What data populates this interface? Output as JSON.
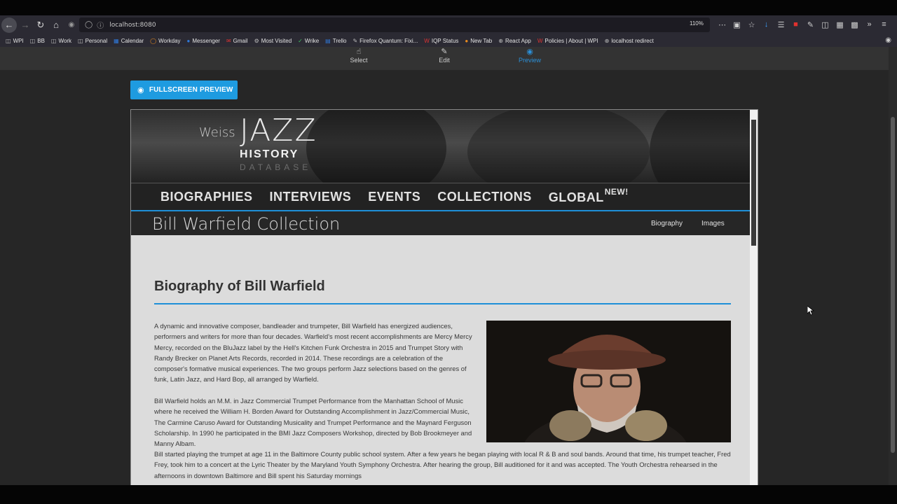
{
  "browser": {
    "url": "localhost:8080",
    "zoom": "110%",
    "bookmarks": [
      {
        "label": "WPI",
        "icon": "folder-icon"
      },
      {
        "label": "BB",
        "icon": "folder-icon"
      },
      {
        "label": "Work",
        "icon": "folder-icon"
      },
      {
        "label": "Personal",
        "icon": "folder-icon"
      },
      {
        "label": "Calendar",
        "icon": "calendar-icon"
      },
      {
        "label": "Workday",
        "icon": "workday-icon"
      },
      {
        "label": "Messenger",
        "icon": "messenger-icon"
      },
      {
        "label": "Gmail",
        "icon": "gmail-icon"
      },
      {
        "label": "Most Visited",
        "icon": "gear-icon"
      },
      {
        "label": "Wrike",
        "icon": "check-icon"
      },
      {
        "label": "Trello",
        "icon": "trello-icon"
      },
      {
        "label": "Firefox Quantum: Fixi...",
        "icon": "brush-icon"
      },
      {
        "label": "IQP Status",
        "icon": "w-icon"
      },
      {
        "label": "New Tab",
        "icon": "firefox-icon"
      },
      {
        "label": "React App",
        "icon": "globe-icon"
      },
      {
        "label": "Policies | About | WPI",
        "icon": "w-icon"
      },
      {
        "label": "localhost redirect",
        "icon": "globe-icon"
      }
    ]
  },
  "editor": {
    "modes": [
      {
        "label": "Select",
        "icon": "hand-icon"
      },
      {
        "label": "Edit",
        "icon": "pencil-icon"
      },
      {
        "label": "Preview",
        "icon": "eye-icon"
      }
    ],
    "active_mode": "Preview",
    "fullscreen_label": "FULLSCREEN PREVIEW"
  },
  "site": {
    "logo": {
      "weiss": "Weiss",
      "jazz": "JAZZ",
      "history": "HISTORY",
      "database": "DATABASE"
    },
    "nav": [
      "BIOGRAPHIES",
      "INTERVIEWS",
      "EVENTS",
      "COLLECTIONS",
      "GLOBAL"
    ],
    "nav_badge": "NEW!",
    "collection_title": "Bill Warfield Collection",
    "collection_links": [
      "Biography",
      "Images"
    ],
    "bio_heading": "Biography of Bill Warfield",
    "paragraphs": [
      "A dynamic and innovative composer, bandleader and trumpeter, Bill Warfield has energized audiences, performers and writers for more than four decades. Warfield's most recent accomplishments are Mercy Mercy Mercy, recorded on the BluJazz label by the Hell's Kitchen Funk Orchestra in 2015 and Trumpet Story with Randy Brecker on Planet Arts Records, recorded in 2014. These recordings are a celebration of the composer's formative musical experiences. The two groups perform Jazz selections based on the genres of funk, Latin Jazz, and Hard Bop, all arranged by Warfield.",
      "Bill Warfield holds an M.M. in Jazz Commercial Trumpet Performance from the Manhattan School of Music where he received the William H. Borden Award for Outstanding Accomplishment in Jazz/Commercial Music, The Carmine Caruso Award for Outstanding Musicality and Trumpet Performance and the Maynard Ferguson Scholarship. In 1990 he participated in the BMI Jazz Composers Workshop, directed by Bob Brookmeyer and Manny Albam.",
      "Bill started playing the trumpet at age 11 in the Baltimore County public school system. After a few years he began playing with local R & B and soul bands. Around that time, his trumpet teacher, Fred Frey, took him to a concert at the Lyric Theater by the Maryland Youth Symphony Orchestra. After hearing the group, Bill auditioned for it and was accepted. The Youth Orchestra rehearsed in the afternoons in downtown Baltimore and Bill spent his Saturday mornings"
    ]
  }
}
